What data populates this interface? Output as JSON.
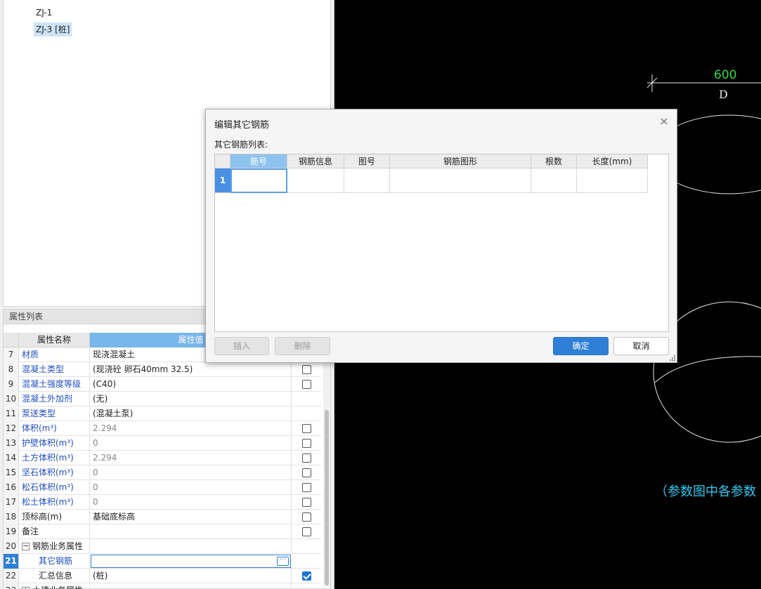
{
  "tree": {
    "items": [
      {
        "label": "ZJ-1",
        "selected": false
      },
      {
        "label": "ZJ-3 [桩]",
        "selected": true
      }
    ]
  },
  "properties": {
    "panel_title": "属性列表",
    "header": {
      "name": "属性名称",
      "value": "属性值"
    },
    "rows": [
      {
        "num": "7",
        "name": "材质",
        "value": "现浇混凝土",
        "checkbox": false
      },
      {
        "num": "8",
        "name": "混凝土类型",
        "value": "(现浇砼 卵石40mm 32.5)",
        "checkbox": "unchecked"
      },
      {
        "num": "9",
        "name": "混凝土强度等级",
        "value": "(C40)",
        "checkbox": "unchecked"
      },
      {
        "num": "10",
        "name": "混凝土外加剂",
        "value": "(无)",
        "checkbox": false
      },
      {
        "num": "11",
        "name": "泵送类型",
        "value": "(混凝土泵)",
        "checkbox": false
      },
      {
        "num": "12",
        "name": "体积(m³)",
        "value": "2.294",
        "checkbox": "unchecked"
      },
      {
        "num": "13",
        "name": "护壁体积(m³)",
        "value": "0",
        "checkbox": "unchecked"
      },
      {
        "num": "14",
        "name": "土方体积(m³)",
        "value": "2.294",
        "checkbox": "unchecked"
      },
      {
        "num": "15",
        "name": "坚石体积(m³)",
        "value": "0",
        "checkbox": "unchecked"
      },
      {
        "num": "16",
        "name": "松石体积(m³)",
        "value": "0",
        "checkbox": "unchecked"
      },
      {
        "num": "17",
        "name": "松土体积(m³)",
        "value": "0",
        "checkbox": "unchecked"
      },
      {
        "num": "18",
        "name": "顶标高(m)",
        "value": "基础底标高",
        "checkbox": "unchecked"
      },
      {
        "num": "19",
        "name": "备注",
        "value": "",
        "checkbox": "unchecked"
      },
      {
        "num": "20",
        "name": "钢筋业务属性",
        "value": "",
        "checkbox": false,
        "group": "−"
      },
      {
        "num": "21",
        "name": "其它钢筋",
        "value": "",
        "checkbox": false,
        "editing": true,
        "active": true
      },
      {
        "num": "22",
        "name": "汇总信息",
        "value": "(桩)",
        "checkbox": "checked"
      },
      {
        "num": "23",
        "name": "土建业务属性",
        "value": "",
        "checkbox": false,
        "group": "+"
      }
    ]
  },
  "cad": {
    "dimension_value": "600",
    "axis_label": "D",
    "note": "（参数图中各参数"
  },
  "dialog": {
    "title": "编辑其它钢筋",
    "close_icon": "×",
    "list_label": "其它钢筋列表:",
    "columns": [
      "筋号",
      "钢筋信息",
      "图号",
      "钢筋图形",
      "根数",
      "长度(mm)"
    ],
    "rows": [
      {
        "num": "1",
        "cells": [
          "",
          "",
          "",
          "",
          "",
          ""
        ]
      }
    ],
    "buttons": {
      "insert": "插入",
      "delete": "删除",
      "ok": "确定",
      "cancel": "取消"
    },
    "ellipsis": "···"
  },
  "colors": {
    "accent": "#2f7fd6",
    "cad_background": "#000000",
    "cad_dimension": "#36d94a",
    "cad_note": "#30c8f0"
  }
}
